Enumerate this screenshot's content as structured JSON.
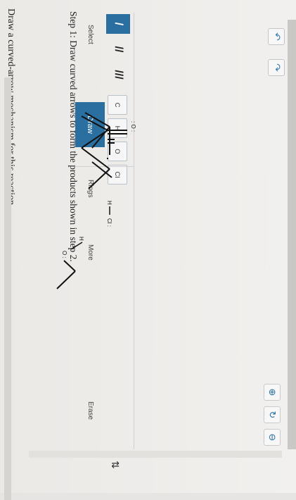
{
  "prompt": "Draw a curved-arrow mechanism for this reaction.",
  "step": "Step 1: Draw curved arrows to form the products shown in step 2.",
  "toolbar": {
    "select": "Select",
    "draw": "Draw",
    "rings": "Rings",
    "more": "More",
    "erase": "Erase"
  },
  "bonds": [
    "/",
    "//",
    "///"
  ],
  "atoms": [
    "C",
    "H",
    "O",
    "Cl"
  ],
  "molecules": {
    "lone_pair_o": ": O :",
    "h_label": "H",
    "cl_label": "Cl :",
    "o_label": "O :"
  },
  "icons": {
    "undo": "undo-icon",
    "redo": "redo-icon",
    "zoom_in": "zoom-in-icon",
    "reset": "reset-icon",
    "zoom_out": "zoom-out-icon",
    "sort": "sort-icon"
  },
  "sort_glyph": "⇅"
}
